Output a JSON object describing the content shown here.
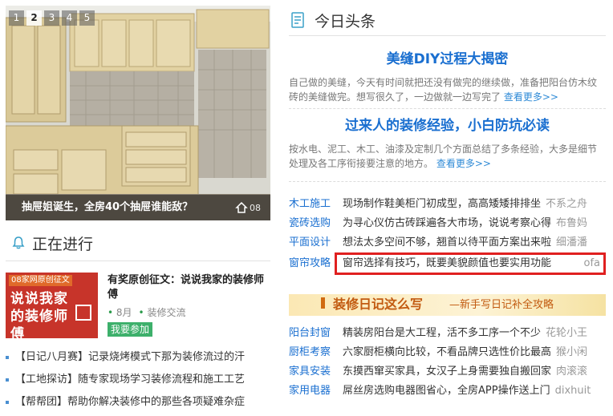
{
  "slider": {
    "pages": [
      "1",
      "2",
      "3",
      "4",
      "5"
    ],
    "active_page": "2",
    "caption": "抽屉姐诞生，全房40个抽屉谁能敌？",
    "watermark": "08"
  },
  "ongoing": {
    "title": "正在进行",
    "feature": {
      "thumb_tag": "08家网原创征文",
      "thumb_text": "说说我家的装修师傅",
      "title": "有奖原创征文：说说我家的装修师傅",
      "month": "8月",
      "category": "装修交流",
      "join_label": "我要参加"
    },
    "items": [
      "【日记八月赛】记录烧烤模式下那为装修流过的汗",
      "【工地探访】随专家现场学习装修流程和施工工艺",
      "【帮帮团】帮助你解决装修中的那些各项疑难杂症"
    ]
  },
  "headlines": {
    "title": "今日头条",
    "stories": [
      {
        "title": "美缝DIY过程大揭密",
        "summary": "自己做的美缝，今天有时间就把还没有做完的继续做，准备把阳台仿木纹砖的美缝做完。想写很久了，一边做就一边写完了",
        "more": "查看更多>>"
      },
      {
        "title": "过来人的装修经验，小白防坑必读",
        "summary": "按水电、泥工、木工、油漆及定制几个方面总结了多条经验，大多是细节处理及各工序衔接要注意的地方。",
        "more": "查看更多>>"
      }
    ]
  },
  "categories_top": [
    {
      "cat": "木工施工",
      "text": "现场制作鞋美柜门初成型，高高矮矮排排坐",
      "tail": "不系之舟"
    },
    {
      "cat": "瓷砖选购",
      "text": "为寻心仪仿古砖踩遍各大市场，说说考察心得",
      "tail": "布鲁妈"
    },
    {
      "cat": "平面设计",
      "text": "想法太多空间不够，翘首以待平面方案出来啦",
      "tail": "细潘潘"
    },
    {
      "cat": "窗帘攻略",
      "text": "窗帘选择有技巧，既要美貌颜值也要实用功能",
      "tail": "ofa"
    }
  ],
  "banner": {
    "title": "装修日记这么写",
    "subtitle": "—新手写日记补全攻略"
  },
  "categories_bottom": [
    {
      "cat": "阳台封窗",
      "text": "精装房阳台是大工程，活不多工序一个不少",
      "tail": "花轮小王"
    },
    {
      "cat": "厨柜考察",
      "text": "六家厨柜横向比较，不看品牌只选性价比最高",
      "tail": "猴小闲"
    },
    {
      "cat": "家具安装",
      "text": "东摸西窜买家具，女汉子上身需要独自搬回家",
      "tail": "肉滚滚"
    },
    {
      "cat": "家用电器",
      "text": "屌丝房选购电器图省心，全房APP操作送上门",
      "tail": "dixhuit"
    }
  ],
  "colors": {
    "link_blue": "#1a6fd0",
    "highlight_red": "#e02020",
    "join_green": "#3db06b",
    "banner_orange": "#c25a10"
  }
}
